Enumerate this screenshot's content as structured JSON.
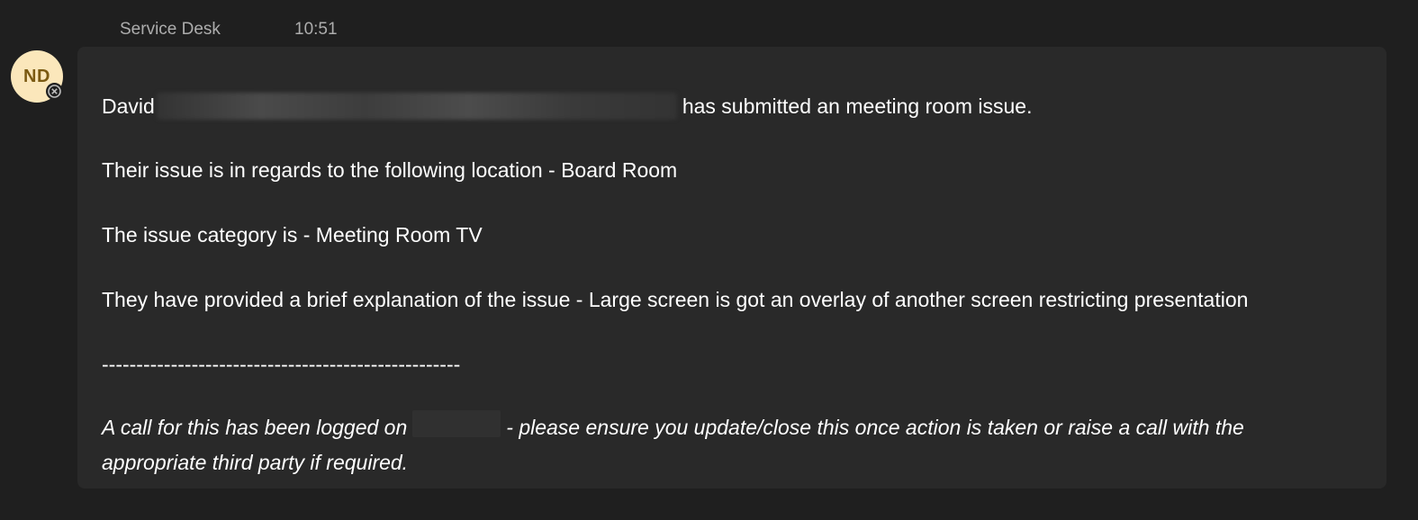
{
  "header": {
    "sender": "Service Desk",
    "time": "10:51"
  },
  "avatar": {
    "initials": "ND",
    "bg_color": "#fbe7bb",
    "text_color": "#7b5a12",
    "status_icon": "blocked-status-icon"
  },
  "message": {
    "line1_prefix": "David",
    "line1_suffix": "has submitted an meeting room issue.",
    "line2": "Their issue is in regards to the following location - Board Room",
    "line3": "The issue category is - Meeting Room TV",
    "line4": "They have provided a brief explanation of the issue - Large screen is got an overlay of another screen restricting presentation",
    "separator": "----------------------------------------------------",
    "footer_prefix": "A call for this has been logged on",
    "footer_suffix": "- please ensure you update/close this once action is taken or raise a call with the appropriate third party  if required."
  },
  "colors": {
    "background": "#1f1f1f",
    "bubble": "#292929",
    "meta_text": "#adadad"
  }
}
